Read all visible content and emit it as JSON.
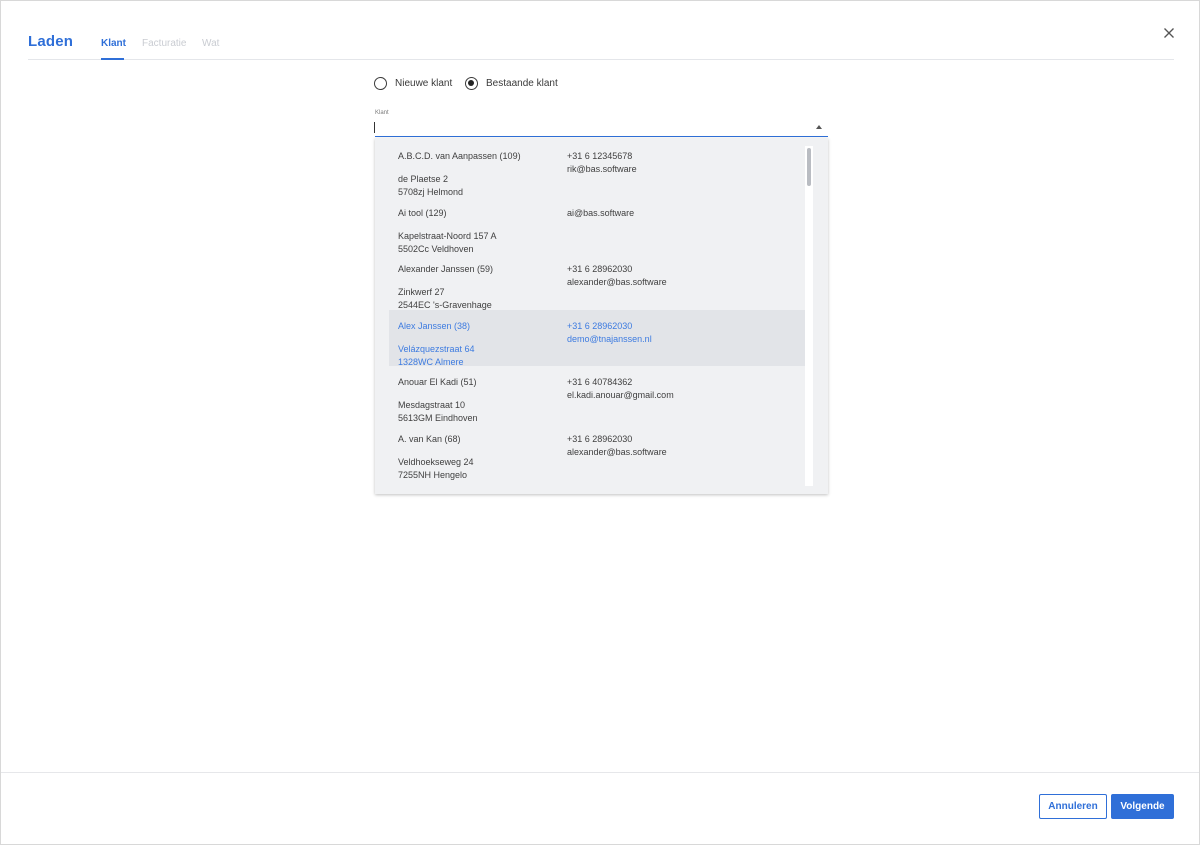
{
  "dialog": {
    "title": "Laden",
    "tabs": [
      {
        "label": "Klant",
        "active": true
      },
      {
        "label": "Facturatie",
        "active": false
      },
      {
        "label": "Wat",
        "active": false
      }
    ],
    "close_icon": "close-icon"
  },
  "customer_type": {
    "options": [
      {
        "label": "Nieuwe klant",
        "checked": false
      },
      {
        "label": "Bestaande klant",
        "checked": true
      }
    ]
  },
  "klant_field": {
    "label": "Klant",
    "value": "",
    "placeholder": ""
  },
  "customers": [
    {
      "name": "A.B.C.D. van Aanpassen (109)",
      "street": "de Plaetse 2",
      "city": "5708zj Helmond",
      "phone": "+31 6 12345678",
      "email": "rik@bas.software",
      "highlighted": false
    },
    {
      "name": "Ai tool (129)",
      "street": "Kapelstraat-Noord 157 A",
      "city": "5502Cc Veldhoven",
      "phone": "",
      "email": "ai@bas.software",
      "highlighted": false
    },
    {
      "name": "Alexander Janssen (59)",
      "street": "Zinkwerf 27",
      "city": "2544EC 's-Gravenhage",
      "phone": "+31 6 28962030",
      "email": "alexander@bas.software",
      "highlighted": false
    },
    {
      "name": "Alex Janssen (38)",
      "street": "Velázquezstraat 64",
      "city": "1328WC Almere",
      "phone": "+31 6 28962030",
      "email": "demo@tnajanssen.nl",
      "highlighted": true
    },
    {
      "name": "Anouar El Kadi (51)",
      "street": "Mesdagstraat 10",
      "city": "5613GM Eindhoven",
      "phone": "+31 6 40784362",
      "email": "el.kadi.anouar@gmail.com",
      "highlighted": false
    },
    {
      "name": "A. van Kan (68)",
      "street": "Veldhoekseweg 24",
      "city": "7255NH Hengelo",
      "phone": "+31 6 28962030",
      "email": "alexander@bas.software",
      "highlighted": false
    }
  ],
  "footer": {
    "cancel_label": "Annuleren",
    "next_label": "Volgende"
  },
  "colors": {
    "accent": "#2f6fd8",
    "highlight_row": "#e2e4e8",
    "panel_bg": "#f0f1f3"
  }
}
